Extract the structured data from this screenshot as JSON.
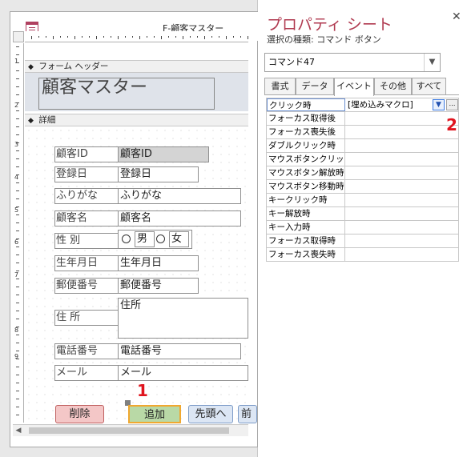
{
  "form_window": {
    "title": "F-顧客マスター",
    "sections": {
      "header": "フォーム ヘッダー",
      "detail": "詳細"
    },
    "header_title": "顧客マスター",
    "ruler_numbers": [
      "1",
      "2",
      "3",
      "4",
      "5",
      "6",
      "7",
      "8",
      "9"
    ],
    "fields": [
      {
        "label": "顧客ID",
        "value": "顧客ID"
      },
      {
        "label": "登録日",
        "value": "登録日"
      },
      {
        "label": "ふりがな",
        "value": "ふりがな"
      },
      {
        "label": "顧客名",
        "value": "顧客名"
      },
      {
        "label": "性 別",
        "value": ""
      },
      {
        "label": "生年月日",
        "value": "生年月日"
      },
      {
        "label": "郵便番号",
        "value": "郵便番号"
      },
      {
        "label": "住 所",
        "value": "住所"
      },
      {
        "label": "電話番号",
        "value": "電話番号"
      },
      {
        "label": "メール",
        "value": "メール"
      }
    ],
    "gender_options": [
      "男",
      "女"
    ],
    "buttons": {
      "delete": "削除",
      "add": "追加",
      "first": "先頭へ",
      "prev": "前"
    },
    "markers": {
      "one": "1"
    }
  },
  "property_sheet": {
    "title": "プロパティ シート",
    "selection_type": "選択の種類: コマンド ボタン",
    "selected_object": "コマンド47",
    "tabs": [
      "書式",
      "データ",
      "イベント",
      "その他",
      "すべて"
    ],
    "active_tab": "イベント",
    "properties": [
      {
        "name": "クリック時",
        "value": "[埋め込みマクロ]"
      },
      {
        "name": "フォーカス取得後",
        "value": ""
      },
      {
        "name": "フォーカス喪失後",
        "value": ""
      },
      {
        "name": "ダブルクリック時",
        "value": ""
      },
      {
        "name": "マウスボタンクリック時",
        "value": ""
      },
      {
        "name": "マウスボタン解放時",
        "value": ""
      },
      {
        "name": "マウスボタン移動時",
        "value": ""
      },
      {
        "name": "キークリック時",
        "value": ""
      },
      {
        "name": "キー解放時",
        "value": ""
      },
      {
        "name": "キー入力時",
        "value": ""
      },
      {
        "name": "フォーカス取得時",
        "value": ""
      },
      {
        "name": "フォーカス喪失時",
        "value": ""
      }
    ],
    "builder_button": "…",
    "markers": {
      "two": "2"
    }
  },
  "colors": {
    "accent": "#b03a50",
    "marker": "#e0141e",
    "add_button": "#b9d9a6",
    "delete_button": "#f4c7c7",
    "header_bg": "#dfe3ea"
  }
}
